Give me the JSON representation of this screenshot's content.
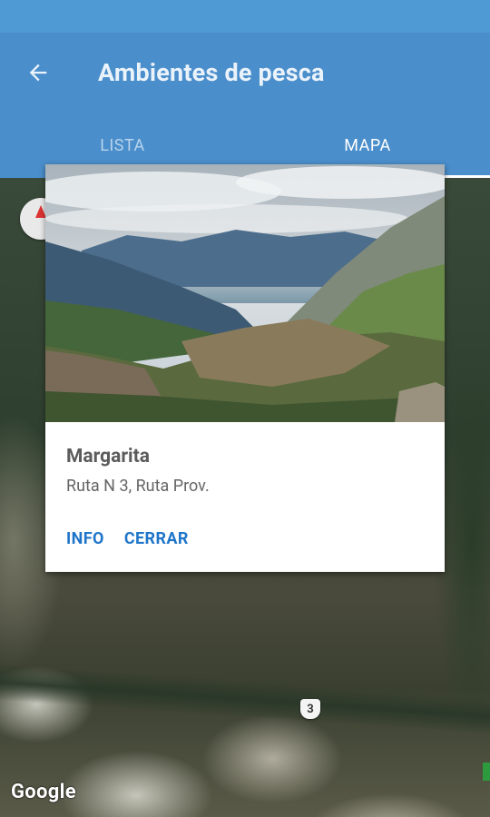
{
  "app_bar": {
    "title": "Ambientes de pesca",
    "back_icon": "arrow-left-icon"
  },
  "tabs": [
    {
      "label": "LISTA",
      "active": false
    },
    {
      "label": "MAPA",
      "active": true
    }
  ],
  "popup": {
    "name": "Margarita",
    "address": "Ruta N 3, Ruta Prov.",
    "actions": {
      "info_label": "INFO",
      "close_label": "CERRAR"
    }
  },
  "map": {
    "route_label": "3",
    "attribution": "Google",
    "compass_icon": "compass-icon"
  },
  "colors": {
    "status_bar": "#4f9ad4",
    "app_bar": "#4a8ecb",
    "accent_button": "#1f75c9"
  }
}
